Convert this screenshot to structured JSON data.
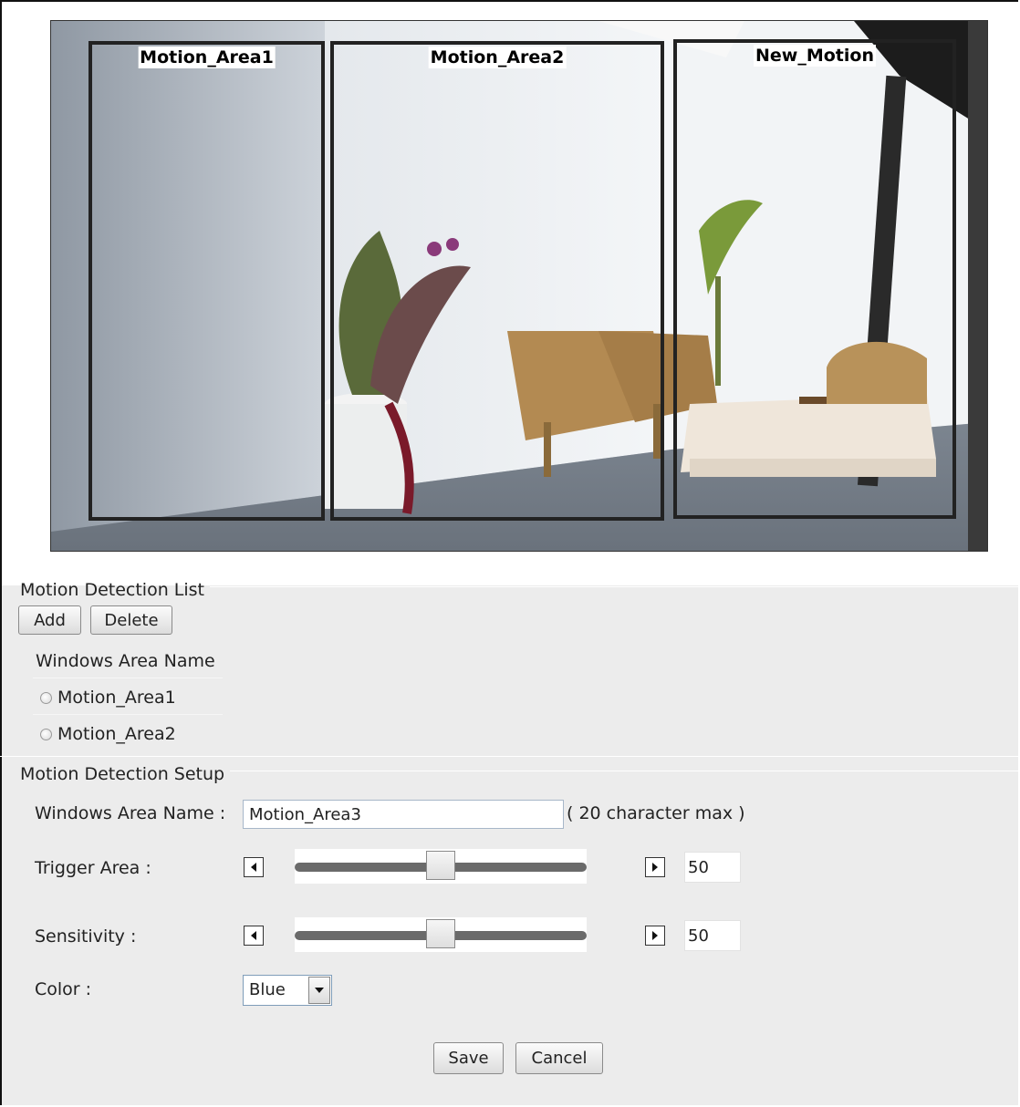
{
  "camera": {
    "zones": [
      {
        "label": "Motion_Area1",
        "color": "#e01a1a"
      },
      {
        "label": "Motion_Area2",
        "color": "#22d422"
      },
      {
        "label": "New_Motion",
        "color": "#1515c8"
      }
    ]
  },
  "list_section": {
    "title": "Motion Detection List",
    "add_label": "Add",
    "delete_label": "Delete",
    "column_header": "Windows Area Name",
    "items": [
      {
        "name": "Motion_Area1"
      },
      {
        "name": "Motion_Area2"
      }
    ]
  },
  "setup_section": {
    "title": "Motion Detection Setup",
    "name_label": "Windows Area Name :",
    "name_value": "Motion_Area3",
    "name_hint": "( 20 character max )",
    "trigger_label": "Trigger Area :",
    "trigger_value": "50",
    "sensitivity_label": "Sensitivity :",
    "sensitivity_value": "50",
    "color_label": "Color :",
    "color_value": "Blue",
    "save_label": "Save",
    "cancel_label": "Cancel"
  }
}
